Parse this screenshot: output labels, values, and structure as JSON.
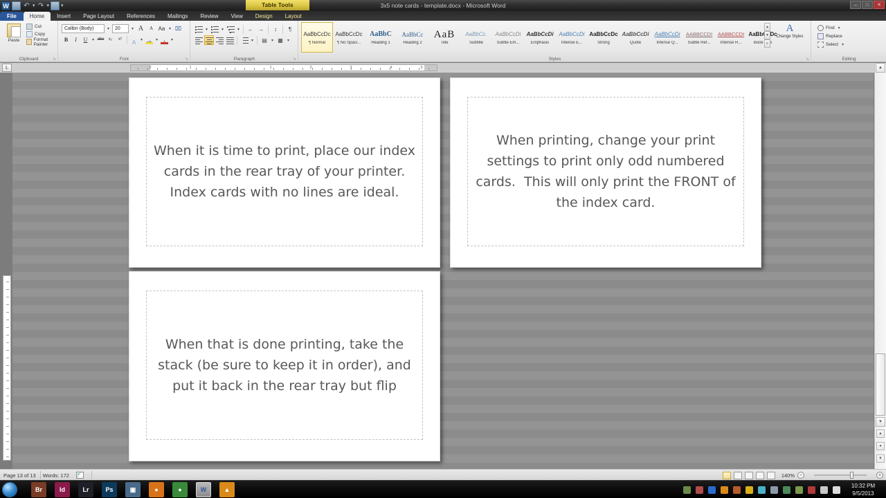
{
  "window": {
    "title": "3x5 note cards - template.docx - Microsoft Word",
    "contextual_tab_group": "Table Tools",
    "minimize": "–",
    "maximize": "□",
    "close": "✕"
  },
  "quick_access": {
    "app_icon": "W",
    "save": "save-icon",
    "undo": "↶",
    "redo": "↷",
    "customize": "▾"
  },
  "tabs": [
    {
      "label": "File",
      "type": "file"
    },
    {
      "label": "Home",
      "type": "active"
    },
    {
      "label": "Insert",
      "type": "normal"
    },
    {
      "label": "Page Layout",
      "type": "normal"
    },
    {
      "label": "References",
      "type": "normal"
    },
    {
      "label": "Mailings",
      "type": "normal"
    },
    {
      "label": "Review",
      "type": "normal"
    },
    {
      "label": "View",
      "type": "normal"
    },
    {
      "label": "Design",
      "type": "ctx"
    },
    {
      "label": "Layout",
      "type": "ctx"
    }
  ],
  "ribbon": {
    "clipboard": {
      "group_label": "Clipboard",
      "paste_label": "Paste",
      "cut_label": "Cut",
      "copy_label": "Copy",
      "format_painter_label": "Format Painter",
      "dialog_launcher": "➘"
    },
    "font": {
      "group_label": "Font",
      "font_name": "Calibri (Body)",
      "font_size": "20",
      "grow_font": "A",
      "shrink_font": "A",
      "change_case": "Aa",
      "clear_formatting": "⌧",
      "bold": "B",
      "italic": "I",
      "underline": "U",
      "strikethrough": "abc",
      "subscript": "x₂",
      "superscript": "x²",
      "text_effects": "A",
      "highlight": "ab",
      "font_color": "A",
      "dialog_launcher": "➘"
    },
    "paragraph": {
      "group_label": "Paragraph",
      "bullets": "bullets-icon",
      "numbering": "numbering-icon",
      "multilevel": "multilevel-list-icon",
      "decrease_indent": "←",
      "increase_indent": "→",
      "sort": "↕",
      "show_marks": "¶",
      "align_left": "align-left-icon",
      "align_center": "align-center-icon",
      "align_right": "align-right-icon",
      "justify": "justify-icon",
      "line_spacing": "line-spacing-icon",
      "shading": "shading-icon",
      "borders": "borders-icon",
      "active_alignment": "align_center",
      "dialog_launcher": "➘"
    },
    "styles": {
      "group_label": "Styles",
      "items": [
        {
          "preview": "AaBbCcDc",
          "name": "¶ Normal",
          "style": "normal",
          "selected": true
        },
        {
          "preview": "AaBbCcDc",
          "name": "¶ No Spaci...",
          "style": "normal",
          "selected": false
        },
        {
          "preview": "AaBbC",
          "name": "Heading 1",
          "style": "h1",
          "selected": false
        },
        {
          "preview": "AaBbCc",
          "name": "Heading 2",
          "style": "h2",
          "selected": false
        },
        {
          "preview": "AaB",
          "name": "Title",
          "style": "title",
          "selected": false
        },
        {
          "preview": "AaBbCc.",
          "name": "Subtitle",
          "style": "subtitle",
          "selected": false
        },
        {
          "preview": "AaBbCcDi",
          "name": "Subtle Em...",
          "style": "subtleem",
          "selected": false
        },
        {
          "preview": "AaBbCcDi",
          "name": "Emphasis",
          "style": "emphasis",
          "selected": false
        },
        {
          "preview": "AaBbCcDi",
          "name": "Intense E...",
          "style": "intenseem",
          "selected": false
        },
        {
          "preview": "AaBbCcDc",
          "name": "Strong",
          "style": "strong",
          "selected": false
        },
        {
          "preview": "AaBbCcDi",
          "name": "Quote",
          "style": "quote",
          "selected": false
        },
        {
          "preview": "AaBbCcDi",
          "name": "Intense Q...",
          "style": "intenseq",
          "selected": false
        },
        {
          "preview": "AABBCCDI",
          "name": "Subtle Ref...",
          "style": "subtleref",
          "selected": false
        },
        {
          "preview": "AABBCCDI",
          "name": "Intense R...",
          "style": "intenser",
          "selected": false
        },
        {
          "preview": "AaBbCcDc",
          "name": "Book Title",
          "style": "booktitle",
          "selected": false
        }
      ],
      "scroll_up": "▲",
      "scroll_down": "▼",
      "more": "≡",
      "change_styles_label": "Change Styles",
      "change_styles_icon": "A",
      "dialog_launcher": "➘"
    },
    "editing": {
      "group_label": "Editing",
      "find_label": "Find",
      "replace_label": "Replace",
      "select_label": "Select",
      "dropdown": "▾"
    }
  },
  "ruler": {
    "tab_selector": "L",
    "numbers": [
      "2",
      "1",
      "1",
      "2",
      "3",
      "4",
      "5"
    ]
  },
  "document": {
    "cards": [
      {
        "text": "When it is time to print, place our index cards in the rear tray of your printer.  Index cards with no lines are ideal."
      },
      {
        "text": "When printing, change your print settings to print only odd numbered cards.  This will only print the FRONT of the index card."
      },
      {
        "text": "When that is done printing, take the stack (be sure to keep it in order), and put it back in the rear tray but flip"
      }
    ]
  },
  "scrollbar": {
    "up_arrow": "▲",
    "down_arrow": "▼",
    "prev_page": "▲",
    "browse_object": "●",
    "next_page": "▼",
    "split": "≡"
  },
  "status_bar": {
    "page": "Page 13 of 13",
    "words": "Words: 172",
    "proofing": "proofing-errors-icon",
    "zoom_level": "140%",
    "zoom_out": "−",
    "zoom_in": "+",
    "views": [
      {
        "name": "print-layout-view",
        "active": true
      },
      {
        "name": "full-screen-reading-view",
        "active": false
      },
      {
        "name": "web-layout-view",
        "active": false
      },
      {
        "name": "outline-view",
        "active": false
      },
      {
        "name": "draft-view",
        "active": false
      }
    ]
  },
  "taskbar": {
    "start": "start-orb",
    "items": [
      {
        "name": "bridge",
        "label": "Br",
        "color": "#7a3b26",
        "active": false
      },
      {
        "name": "indesign",
        "label": "Id",
        "color": "#8a1a4a",
        "active": false
      },
      {
        "name": "lightroom",
        "label": "Lr",
        "color": "#1f1f28",
        "active": false
      },
      {
        "name": "photoshop",
        "label": "Ps",
        "color": "#0d3a5c",
        "active": false
      },
      {
        "name": "display-settings",
        "label": "▣",
        "color": "#4a6a8a",
        "active": false
      },
      {
        "name": "firefox",
        "label": "●",
        "color": "#d9731a",
        "active": false
      },
      {
        "name": "chrome",
        "label": "●",
        "color": "#3a8a3a",
        "active": false
      },
      {
        "name": "word",
        "label": "W",
        "color": "#2b579a",
        "active": true
      },
      {
        "name": "vlc",
        "label": "▲",
        "color": "#d98a1a",
        "active": false
      }
    ],
    "tray": [
      {
        "name": "tray-icon-1",
        "color": "#6a8a4a"
      },
      {
        "name": "tray-icon-2",
        "color": "#b04a4a"
      },
      {
        "name": "tray-icon-bluetooth",
        "color": "#2a6ad0"
      },
      {
        "name": "tray-icon-vlc",
        "color": "#d98a1a"
      },
      {
        "name": "tray-icon-3",
        "color": "#b85a2a"
      },
      {
        "name": "tray-icon-4",
        "color": "#d9b01a"
      },
      {
        "name": "tray-icon-5",
        "color": "#4ab0c8"
      },
      {
        "name": "tray-icon-6",
        "color": "#8a9aa8"
      },
      {
        "name": "tray-icon-7",
        "color": "#4a8a5a"
      },
      {
        "name": "tray-icon-8",
        "color": "#7a9a4a"
      },
      {
        "name": "tray-icon-9",
        "color": "#b03a3a"
      },
      {
        "name": "tray-icon-network",
        "color": "#c8c8c8"
      },
      {
        "name": "tray-icon-volume",
        "color": "#dcdcdc"
      }
    ],
    "time": "10:32 PM",
    "date": "9/5/2013"
  }
}
